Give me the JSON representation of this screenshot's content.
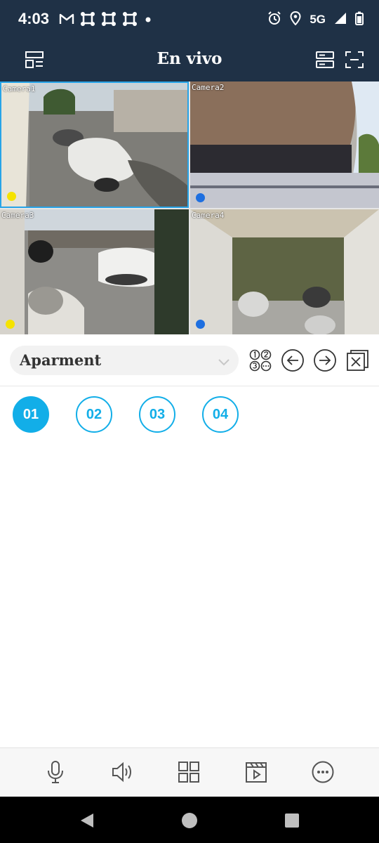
{
  "status_bar": {
    "time": "4:03",
    "network": "5G",
    "icons": [
      "gmail-icon",
      "app-icon",
      "app-icon",
      "app-icon",
      "dot-icon",
      "alarm-icon",
      "location-icon",
      "signal-icon",
      "battery-icon"
    ]
  },
  "app_bar": {
    "title": "En vivo",
    "left_icon": "layout-icon",
    "right_icons": [
      "device-list-icon",
      "fullscreen-icon"
    ]
  },
  "cameras": [
    {
      "label": "Camera1",
      "status_color": "#f5e300",
      "selected": true
    },
    {
      "label": "Camera2",
      "status_color": "#1e6fe0",
      "selected": false
    },
    {
      "label": "Camera3",
      "status_color": "#f5e300",
      "selected": false
    },
    {
      "label": "Camera4",
      "status_color": "#1e6fe0",
      "selected": false
    }
  ],
  "controls": {
    "group_name": "Aparment",
    "icons": [
      "sequence-icon",
      "previous-icon",
      "next-icon",
      "close-all-icon"
    ]
  },
  "channels": [
    "01",
    "02",
    "03",
    "04"
  ],
  "active_channel": "01",
  "toolbar": {
    "icons": [
      "microphone-icon",
      "speaker-icon",
      "grid-icon",
      "playback-icon",
      "more-icon"
    ]
  },
  "colors": {
    "header_bg": "#1f3146",
    "accent": "#12aee8"
  }
}
